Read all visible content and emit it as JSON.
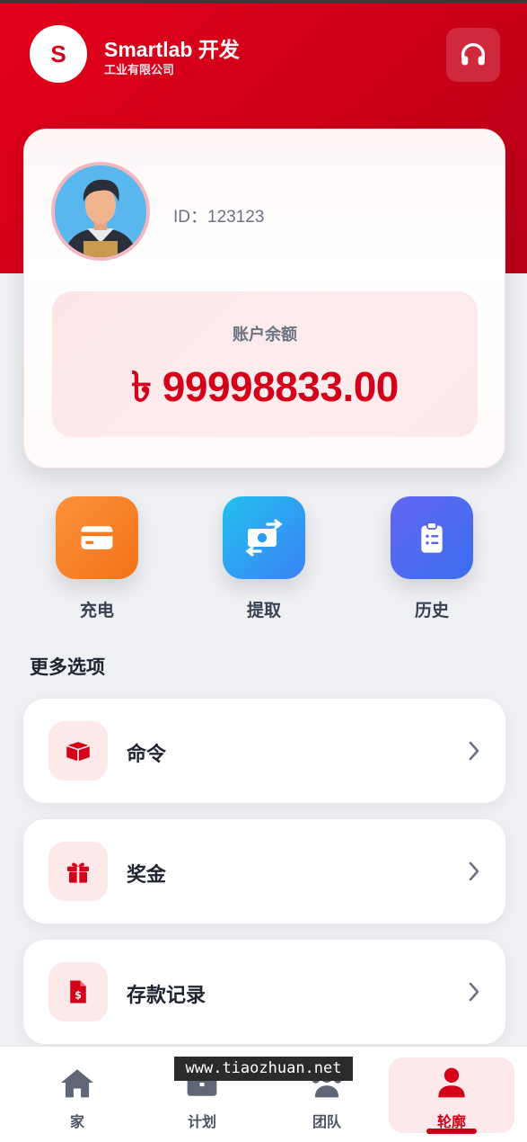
{
  "header": {
    "brand_initial": "S",
    "brand_name": "Smartlab 开发",
    "brand_subtitle": "工业有限公司"
  },
  "profile": {
    "id_text": "ID：123123",
    "balance_label": "账户余额",
    "balance_amount": "৳ 99998833.00"
  },
  "quick_actions": [
    {
      "label": "充电",
      "icon": "credit-card-icon",
      "color": "#f97316"
    },
    {
      "label": "提取",
      "icon": "money-transfer-icon",
      "color": "#1fa9ef"
    },
    {
      "label": "历史",
      "icon": "clipboard-list-icon",
      "color": "#5b5cf0"
    }
  ],
  "more": {
    "title": "更多选项",
    "items": [
      {
        "label": "命令",
        "icon": "box-icon"
      },
      {
        "label": "奖金",
        "icon": "gift-icon"
      },
      {
        "label": "存款记录",
        "icon": "dollar-file-icon"
      }
    ]
  },
  "nav": [
    {
      "label": "家",
      "icon": "home-icon"
    },
    {
      "label": "计划",
      "icon": "briefcase-icon"
    },
    {
      "label": "团队",
      "icon": "team-icon"
    },
    {
      "label": "轮廓",
      "icon": "user-icon",
      "active": true
    }
  ],
  "watermark": "www.tiaozhuan.net",
  "colors": {
    "primary": "#d4001a",
    "background": "#eef0f4"
  }
}
